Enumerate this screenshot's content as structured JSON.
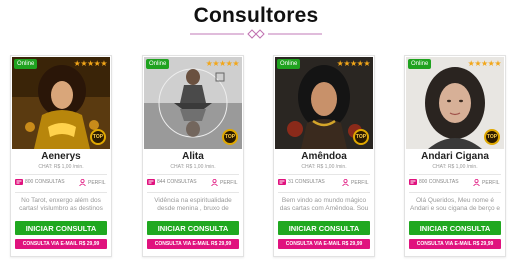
{
  "page": {
    "title": "Consultores"
  },
  "colors": {
    "online": "#1fa21f",
    "start_button": "#20a820",
    "email_button": "#e0127e",
    "stars": "#f2a619",
    "divider": "#d6a6cf"
  },
  "cards": [
    {
      "status": "Online",
      "stars": "★★★★★",
      "badge": "TOP",
      "name": "Aenerys",
      "chat": "CHAT: R$ 1,00 /min.",
      "consultas": "800 CONSULTAS",
      "perfil": "PERFIL",
      "description": "No Tarot, enxergo além dos cartas! vislumbro as destinos",
      "start_label": "INICIAR CONSULTA",
      "email_label": "CONSULTA VIA E-MAIL R$ 29,99",
      "photo_icon": "portrait-image"
    },
    {
      "status": "Online",
      "stars": "★★★★★",
      "badge": "TOP",
      "name": "Alita",
      "chat": "CHAT: R$ 1,00 /min.",
      "consultas": "844 CONSULTAS",
      "perfil": "PERFIL",
      "description": "Vidência na espiritualidade desde menina , bruxo de",
      "start_label": "INICIAR CONSULTA",
      "email_label": "CONSULTA VIA E-MAIL R$ 29,99",
      "photo_icon": "portrait-image"
    },
    {
      "status": "Online",
      "stars": "★★★★★",
      "badge": "TOP",
      "name": "Amêndoa",
      "chat": "CHAT: R$ 1,00 /min.",
      "consultas": "31 CONSULTAS",
      "perfil": "PERFIL",
      "description": "Bem vindo ao mundo mágico das cartas com Amêndoa. Sou",
      "start_label": "INICIAR CONSULTA",
      "email_label": "CONSULTA VIA E-MAIL R$ 29,99",
      "photo_icon": "portrait-image"
    },
    {
      "status": "Online",
      "stars": "★★★★★",
      "badge": "TOP",
      "name": "Andari Cigana",
      "chat": "CHAT: R$ 1,00 /min.",
      "consultas": "800 CONSULTAS",
      "perfil": "PERFIL",
      "description": "Olá Queridos, Meu nome é Andari e sou cigana de berço e",
      "start_label": "INICIAR CONSULTA",
      "email_label": "CONSULTA VIA E-MAIL R$ 29,99",
      "photo_icon": "portrait-image"
    }
  ]
}
